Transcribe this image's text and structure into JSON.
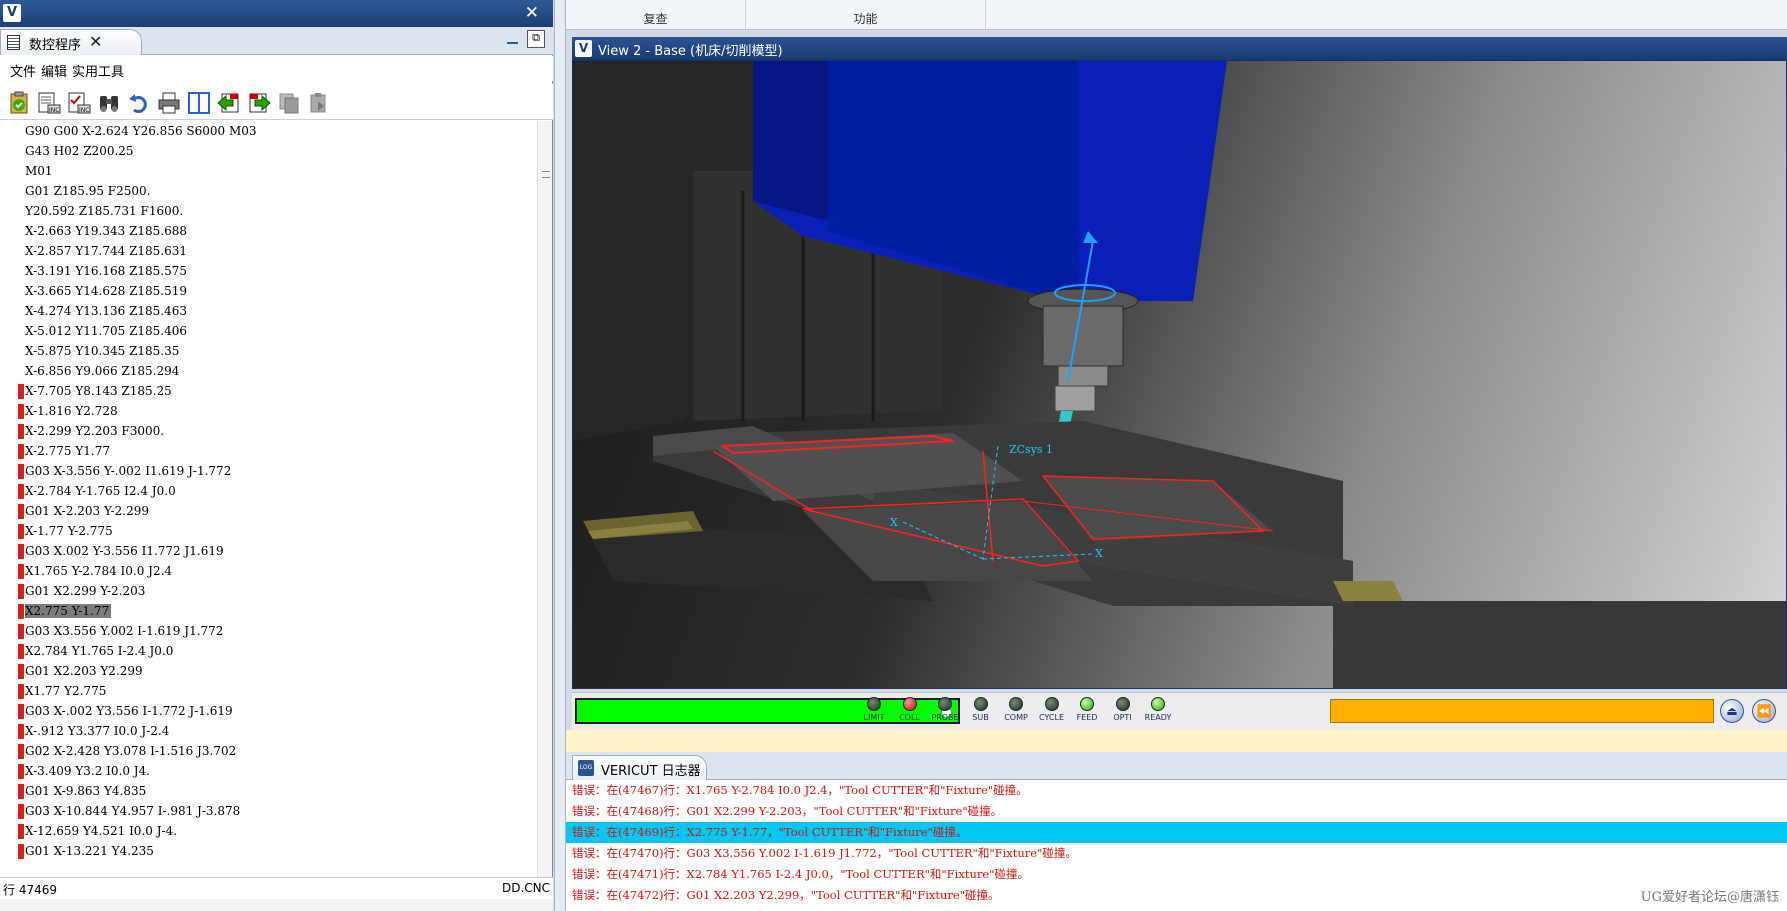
{
  "left_window": {
    "tab_label": "数控程序",
    "menu": [
      "文件",
      "编辑",
      "实用工具"
    ],
    "toolbar_icons": [
      "clipboard-check-icon",
      "nc-file-icon",
      "nc-check-icon",
      "binoculars-icon",
      "undo-icon",
      "print-icon",
      "split-view-icon",
      "step-back-icon",
      "step-forward-icon",
      "copy-disabled-icon",
      "paste-disabled-icon"
    ],
    "code_lines": [
      {
        "text": "G90 G00 X-2.624 Y26.856 S6000 M03",
        "marked": false,
        "selected": false
      },
      {
        "text": "G43 H02 Z200.25",
        "marked": false,
        "selected": false
      },
      {
        "text": "M01",
        "marked": false,
        "selected": false
      },
      {
        "text": "G01 Z185.95 F2500.",
        "marked": false,
        "selected": false
      },
      {
        "text": "Y20.592 Z185.731 F1600.",
        "marked": false,
        "selected": false
      },
      {
        "text": "X-2.663 Y19.343 Z185.688",
        "marked": false,
        "selected": false
      },
      {
        "text": "X-2.857 Y17.744 Z185.631",
        "marked": false,
        "selected": false
      },
      {
        "text": "X-3.191 Y16.168 Z185.575",
        "marked": false,
        "selected": false
      },
      {
        "text": "X-3.665 Y14.628 Z185.519",
        "marked": false,
        "selected": false
      },
      {
        "text": "X-4.274 Y13.136 Z185.463",
        "marked": false,
        "selected": false
      },
      {
        "text": "X-5.012 Y11.705 Z185.406",
        "marked": false,
        "selected": false
      },
      {
        "text": "X-5.875 Y10.345 Z185.35",
        "marked": false,
        "selected": false
      },
      {
        "text": "X-6.856 Y9.066 Z185.294",
        "marked": false,
        "selected": false
      },
      {
        "text": "X-7.705 Y8.143 Z185.25",
        "marked": true,
        "selected": false
      },
      {
        "text": "X-1.816 Y2.728",
        "marked": true,
        "selected": false
      },
      {
        "text": "X-2.299 Y2.203 F3000.",
        "marked": true,
        "selected": false
      },
      {
        "text": "X-2.775 Y1.77",
        "marked": true,
        "selected": false
      },
      {
        "text": "G03 X-3.556 Y-.002 I1.619 J-1.772",
        "marked": true,
        "selected": false
      },
      {
        "text": "X-2.784 Y-1.765 I2.4 J0.0",
        "marked": true,
        "selected": false
      },
      {
        "text": "G01 X-2.203 Y-2.299",
        "marked": true,
        "selected": false
      },
      {
        "text": "X-1.77 Y-2.775",
        "marked": true,
        "selected": false
      },
      {
        "text": "G03 X.002 Y-3.556 I1.772 J1.619",
        "marked": true,
        "selected": false
      },
      {
        "text": "X1.765 Y-2.784 I0.0 J2.4",
        "marked": true,
        "selected": false
      },
      {
        "text": "G01 X2.299 Y-2.203",
        "marked": true,
        "selected": false
      },
      {
        "text": "X2.775 Y-1.77",
        "marked": true,
        "selected": true
      },
      {
        "text": "G03 X3.556 Y.002 I-1.619 J1.772",
        "marked": true,
        "selected": false
      },
      {
        "text": "X2.784 Y1.765 I-2.4 J0.0",
        "marked": true,
        "selected": false
      },
      {
        "text": "G01 X2.203 Y2.299",
        "marked": true,
        "selected": false
      },
      {
        "text": "X1.77 Y2.775",
        "marked": true,
        "selected": false
      },
      {
        "text": "G03 X-.002 Y3.556 I-1.772 J-1.619",
        "marked": true,
        "selected": false
      },
      {
        "text": "X-.912 Y3.377 I0.0 J-2.4",
        "marked": true,
        "selected": false
      },
      {
        "text": "G02 X-2.428 Y3.078 I-1.516 J3.702",
        "marked": true,
        "selected": false
      },
      {
        "text": "X-3.409 Y3.2 I0.0 J4.",
        "marked": true,
        "selected": false
      },
      {
        "text": "G01 X-9.863 Y4.835",
        "marked": true,
        "selected": false
      },
      {
        "text": "G03 X-10.844 Y4.957 I-.981 J-3.878",
        "marked": true,
        "selected": false
      },
      {
        "text": "X-12.659 Y4.521 I0.0 J-4.",
        "marked": true,
        "selected": false
      },
      {
        "text": "G01 X-13.221 Y4.235",
        "marked": true,
        "selected": false
      }
    ],
    "status_line": "行 47469",
    "file_name": "DD.CNC"
  },
  "ribbon": {
    "groups": [
      "复查",
      "功能"
    ]
  },
  "view": {
    "title": "View 2 - Base (机床/切削模型)",
    "csys_label": "ZCsys 1",
    "axis_x": "X"
  },
  "anim_bar": {
    "progress": 1.0,
    "leds": [
      {
        "label": "LIMIT",
        "state": "off"
      },
      {
        "label": "COLL",
        "state": "red"
      },
      {
        "label": "PROBE",
        "state": "off"
      },
      {
        "label": "SUB",
        "state": "off"
      },
      {
        "label": "COMP",
        "state": "off"
      },
      {
        "label": "CYCLE",
        "state": "off"
      },
      {
        "label": "FEED",
        "state": "green"
      },
      {
        "label": "OPTI",
        "state": "off"
      },
      {
        "label": "READY",
        "state": "green"
      }
    ],
    "nav_icons": [
      "eject-icon",
      "rewind-icon"
    ]
  },
  "log": {
    "tab_label": "VERICUT 日志器",
    "lines": [
      {
        "text": "错误：在(47467)行：X1.765 Y-2.784 I0.0 J2.4，\"Tool CUTTER\"和\"Fixture\"碰撞。",
        "selected": false
      },
      {
        "text": "错误：在(47468)行：G01 X2.299 Y-2.203，\"Tool CUTTER\"和\"Fixture\"碰撞。",
        "selected": false
      },
      {
        "text": "错误：在(47469)行：X2.775 Y-1.77，\"Tool CUTTER\"和\"Fixture\"碰撞。",
        "selected": true
      },
      {
        "text": "错误：在(47470)行：G03 X3.556 Y.002 I-1.619 J1.772，\"Tool CUTTER\"和\"Fixture\"碰撞。",
        "selected": false
      },
      {
        "text": "错误：在(47471)行：X2.784 Y1.765 I-2.4 J0.0，\"Tool CUTTER\"和\"Fixture\"碰撞。",
        "selected": false
      },
      {
        "text": "错误：在(47472)行：G01 X2.203 Y2.299，\"Tool CUTTER\"和\"Fixture\"碰撞。",
        "selected": false
      }
    ],
    "watermark": "UG爱好者论坛@唐潇钰"
  }
}
